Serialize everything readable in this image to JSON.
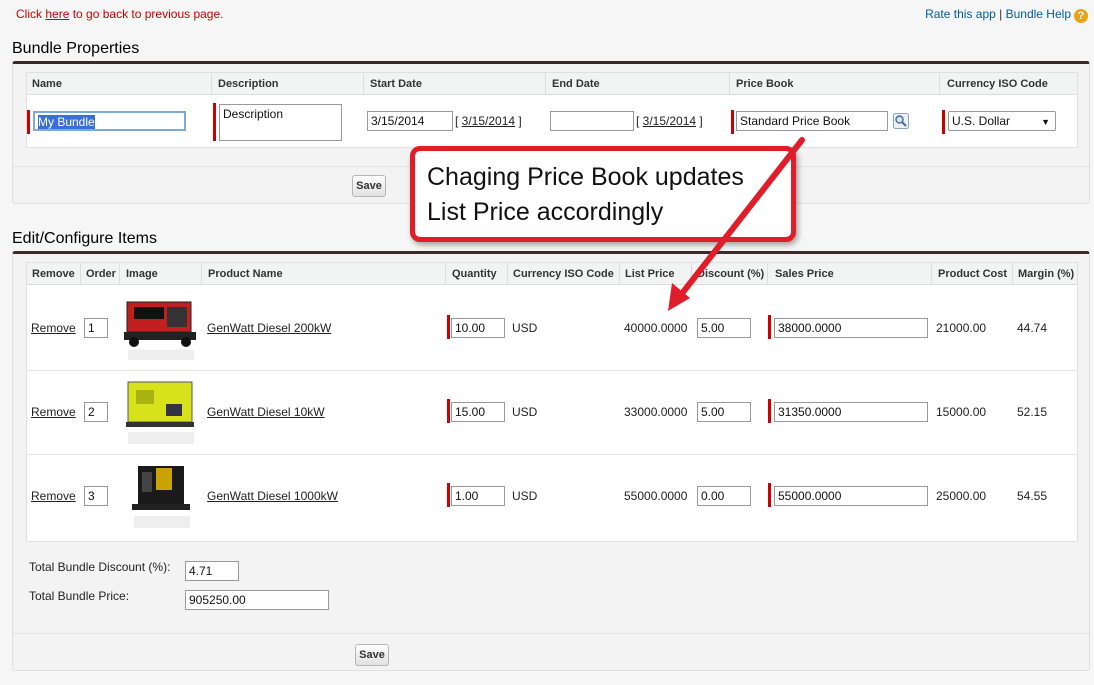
{
  "topbar": {
    "back_prefix": "Click ",
    "back_link": "here",
    "back_suffix": " to go back to previous page.",
    "rate_link": "Rate this app",
    "separator": " | ",
    "help_link": "Bundle Help",
    "help_icon_glyph": "?"
  },
  "bundle": {
    "title": "Bundle Properties",
    "headers": {
      "name": "Name",
      "description": "Description",
      "start_date": "Start Date",
      "end_date": "End Date",
      "price_book": "Price Book",
      "currency": "Currency ISO Code"
    },
    "name_value": "My Bundle",
    "description_value": "Description",
    "start_date_value": "3/15/2014",
    "start_date_link": "3/15/2014",
    "end_date_value": "",
    "end_date_link": "3/15/2014",
    "price_book_value": "Standard Price Book",
    "currency_value": "U.S. Dollar",
    "save_label": "Save"
  },
  "items": {
    "title": "Edit/Configure Items",
    "headers": {
      "remove": "Remove",
      "order": "Order",
      "image": "Image",
      "product_name": "Product Name",
      "quantity": "Quantity",
      "currency": "Currency ISO Code",
      "list_price": "List Price",
      "discount": "Discount (%)",
      "sales_price": "Sales Price",
      "product_cost": "Product Cost",
      "margin": "Margin (%)"
    },
    "rows": [
      {
        "remove": "Remove",
        "order": "1",
        "product": "GenWatt Diesel 200kW",
        "quantity": "10.00",
        "currency": "USD",
        "list_price": "40000.0000",
        "discount": "5.00",
        "sales_price": "38000.0000",
        "cost": "21000.00",
        "margin": "44.74"
      },
      {
        "remove": "Remove",
        "order": "2",
        "product": "GenWatt Diesel 10kW",
        "quantity": "15.00",
        "currency": "USD",
        "list_price": "33000.0000",
        "discount": "5.00",
        "sales_price": "31350.0000",
        "cost": "15000.00",
        "margin": "52.15"
      },
      {
        "remove": "Remove",
        "order": "3",
        "product": "GenWatt Diesel 1000kW",
        "quantity": "1.00",
        "currency": "USD",
        "list_price": "55000.0000",
        "discount": "0.00",
        "sales_price": "55000.0000",
        "cost": "25000.00",
        "margin": "54.55"
      }
    ],
    "total_discount_label": "Total Bundle Discount (%):",
    "total_discount_value": "4.71",
    "total_price_label": "Total Bundle Price:",
    "total_price_value": "905250.00",
    "save_label": "Save"
  },
  "callout": {
    "line1": "Chaging Price Book updates",
    "line2": "List Price accordingly"
  },
  "colors": {
    "required": "#cc0000",
    "link_red": "#cc0000",
    "help_blue": "#015ba7",
    "callout_border": "#e11d2a",
    "panel_top_border": "#3a2a2a"
  },
  "icons": [
    "lookup-icon",
    "help-icon",
    "dropdown-arrow-icon",
    "generator-image"
  ]
}
